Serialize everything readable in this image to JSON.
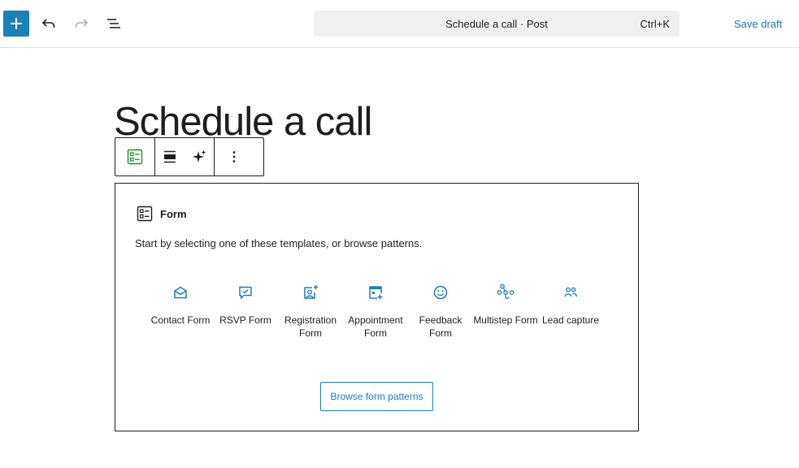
{
  "topbar": {
    "command_title": "Schedule a call · Post",
    "shortcut": "Ctrl+K",
    "save_draft": "Save draft"
  },
  "post": {
    "title": "Schedule a call"
  },
  "form_block": {
    "label": "Form",
    "instructions": "Start by selecting one of these templates, or browse patterns.",
    "templates": [
      {
        "label": "Contact Form",
        "icon": "envelope-open-icon"
      },
      {
        "label": "RSVP Form",
        "icon": "chat-check-icon"
      },
      {
        "label": "Registration Form",
        "icon": "user-add-icon"
      },
      {
        "label": "Appointment Form",
        "icon": "calendar-add-icon"
      },
      {
        "label": "Feedback Form",
        "icon": "smiley-icon"
      },
      {
        "label": "Multistep Form",
        "icon": "multistep-icon"
      },
      {
        "label": "Lead capture",
        "icon": "people-icon"
      }
    ],
    "browse_label": "Browse form patterns"
  },
  "colors": {
    "accent": "#1b7fb8",
    "link": "#2271b1",
    "block_icon_green": "#1a8f2e",
    "text": "#1e1e1e"
  }
}
